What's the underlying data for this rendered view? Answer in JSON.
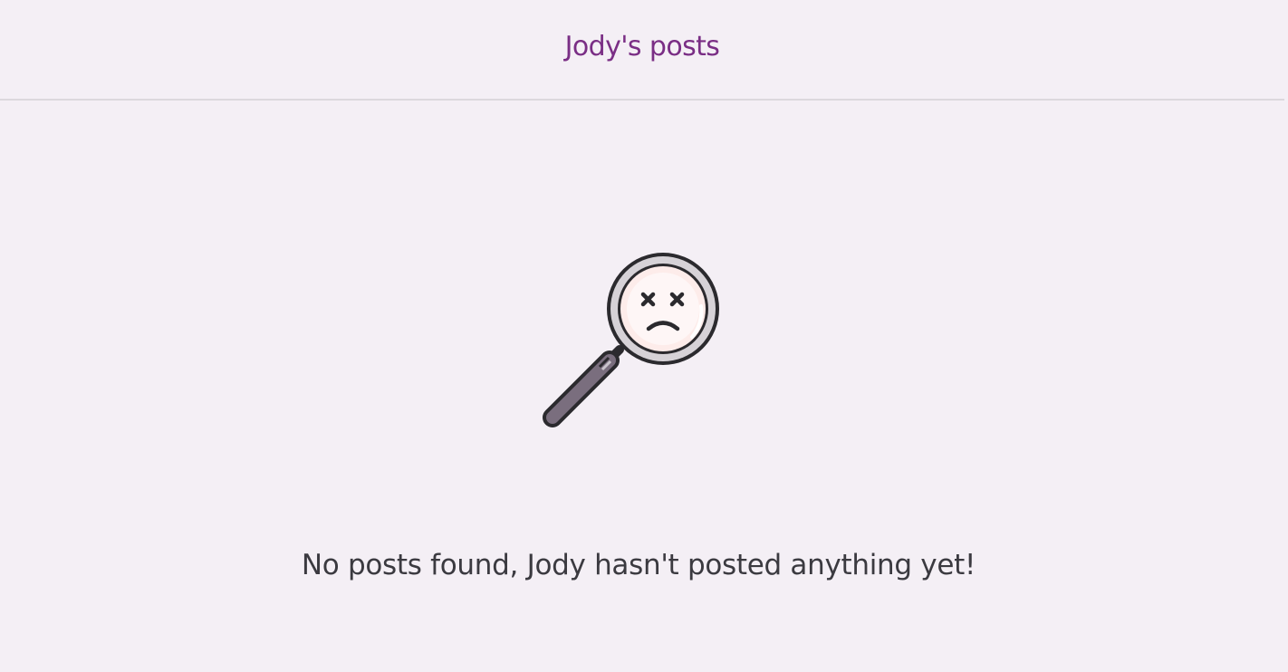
{
  "header": {
    "title": "Jody's posts"
  },
  "empty_state": {
    "icon": "magnifier-sad-face-icon",
    "message": "No posts found, Jody hasn't posted anything yet!"
  },
  "colors": {
    "background": "#f4eff5",
    "title": "#7a2e85",
    "text": "#3b3a40",
    "divider": "#dcd8dd",
    "lens_fill": "#fdecea",
    "handle": "#7a6e7e"
  }
}
